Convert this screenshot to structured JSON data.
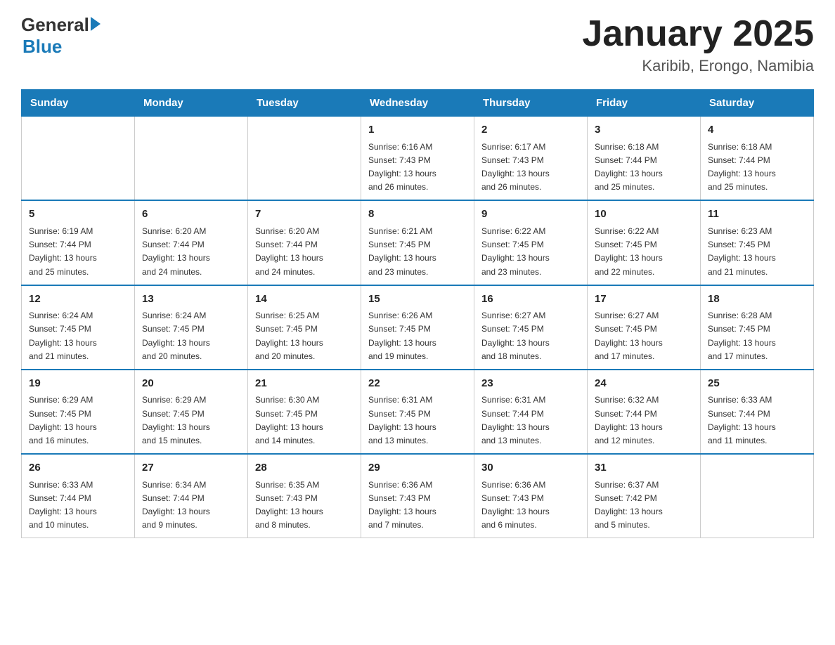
{
  "header": {
    "logo_general": "General",
    "logo_blue": "Blue",
    "title": "January 2025",
    "subtitle": "Karibib, Erongo, Namibia"
  },
  "calendar": {
    "days_of_week": [
      "Sunday",
      "Monday",
      "Tuesday",
      "Wednesday",
      "Thursday",
      "Friday",
      "Saturday"
    ],
    "weeks": [
      [
        {
          "day": "",
          "info": ""
        },
        {
          "day": "",
          "info": ""
        },
        {
          "day": "",
          "info": ""
        },
        {
          "day": "1",
          "info": "Sunrise: 6:16 AM\nSunset: 7:43 PM\nDaylight: 13 hours\nand 26 minutes."
        },
        {
          "day": "2",
          "info": "Sunrise: 6:17 AM\nSunset: 7:43 PM\nDaylight: 13 hours\nand 26 minutes."
        },
        {
          "day": "3",
          "info": "Sunrise: 6:18 AM\nSunset: 7:44 PM\nDaylight: 13 hours\nand 25 minutes."
        },
        {
          "day": "4",
          "info": "Sunrise: 6:18 AM\nSunset: 7:44 PM\nDaylight: 13 hours\nand 25 minutes."
        }
      ],
      [
        {
          "day": "5",
          "info": "Sunrise: 6:19 AM\nSunset: 7:44 PM\nDaylight: 13 hours\nand 25 minutes."
        },
        {
          "day": "6",
          "info": "Sunrise: 6:20 AM\nSunset: 7:44 PM\nDaylight: 13 hours\nand 24 minutes."
        },
        {
          "day": "7",
          "info": "Sunrise: 6:20 AM\nSunset: 7:44 PM\nDaylight: 13 hours\nand 24 minutes."
        },
        {
          "day": "8",
          "info": "Sunrise: 6:21 AM\nSunset: 7:45 PM\nDaylight: 13 hours\nand 23 minutes."
        },
        {
          "day": "9",
          "info": "Sunrise: 6:22 AM\nSunset: 7:45 PM\nDaylight: 13 hours\nand 23 minutes."
        },
        {
          "day": "10",
          "info": "Sunrise: 6:22 AM\nSunset: 7:45 PM\nDaylight: 13 hours\nand 22 minutes."
        },
        {
          "day": "11",
          "info": "Sunrise: 6:23 AM\nSunset: 7:45 PM\nDaylight: 13 hours\nand 21 minutes."
        }
      ],
      [
        {
          "day": "12",
          "info": "Sunrise: 6:24 AM\nSunset: 7:45 PM\nDaylight: 13 hours\nand 21 minutes."
        },
        {
          "day": "13",
          "info": "Sunrise: 6:24 AM\nSunset: 7:45 PM\nDaylight: 13 hours\nand 20 minutes."
        },
        {
          "day": "14",
          "info": "Sunrise: 6:25 AM\nSunset: 7:45 PM\nDaylight: 13 hours\nand 20 minutes."
        },
        {
          "day": "15",
          "info": "Sunrise: 6:26 AM\nSunset: 7:45 PM\nDaylight: 13 hours\nand 19 minutes."
        },
        {
          "day": "16",
          "info": "Sunrise: 6:27 AM\nSunset: 7:45 PM\nDaylight: 13 hours\nand 18 minutes."
        },
        {
          "day": "17",
          "info": "Sunrise: 6:27 AM\nSunset: 7:45 PM\nDaylight: 13 hours\nand 17 minutes."
        },
        {
          "day": "18",
          "info": "Sunrise: 6:28 AM\nSunset: 7:45 PM\nDaylight: 13 hours\nand 17 minutes."
        }
      ],
      [
        {
          "day": "19",
          "info": "Sunrise: 6:29 AM\nSunset: 7:45 PM\nDaylight: 13 hours\nand 16 minutes."
        },
        {
          "day": "20",
          "info": "Sunrise: 6:29 AM\nSunset: 7:45 PM\nDaylight: 13 hours\nand 15 minutes."
        },
        {
          "day": "21",
          "info": "Sunrise: 6:30 AM\nSunset: 7:45 PM\nDaylight: 13 hours\nand 14 minutes."
        },
        {
          "day": "22",
          "info": "Sunrise: 6:31 AM\nSunset: 7:45 PM\nDaylight: 13 hours\nand 13 minutes."
        },
        {
          "day": "23",
          "info": "Sunrise: 6:31 AM\nSunset: 7:44 PM\nDaylight: 13 hours\nand 13 minutes."
        },
        {
          "day": "24",
          "info": "Sunrise: 6:32 AM\nSunset: 7:44 PM\nDaylight: 13 hours\nand 12 minutes."
        },
        {
          "day": "25",
          "info": "Sunrise: 6:33 AM\nSunset: 7:44 PM\nDaylight: 13 hours\nand 11 minutes."
        }
      ],
      [
        {
          "day": "26",
          "info": "Sunrise: 6:33 AM\nSunset: 7:44 PM\nDaylight: 13 hours\nand 10 minutes."
        },
        {
          "day": "27",
          "info": "Sunrise: 6:34 AM\nSunset: 7:44 PM\nDaylight: 13 hours\nand 9 minutes."
        },
        {
          "day": "28",
          "info": "Sunrise: 6:35 AM\nSunset: 7:43 PM\nDaylight: 13 hours\nand 8 minutes."
        },
        {
          "day": "29",
          "info": "Sunrise: 6:36 AM\nSunset: 7:43 PM\nDaylight: 13 hours\nand 7 minutes."
        },
        {
          "day": "30",
          "info": "Sunrise: 6:36 AM\nSunset: 7:43 PM\nDaylight: 13 hours\nand 6 minutes."
        },
        {
          "day": "31",
          "info": "Sunrise: 6:37 AM\nSunset: 7:42 PM\nDaylight: 13 hours\nand 5 minutes."
        },
        {
          "day": "",
          "info": ""
        }
      ]
    ]
  }
}
